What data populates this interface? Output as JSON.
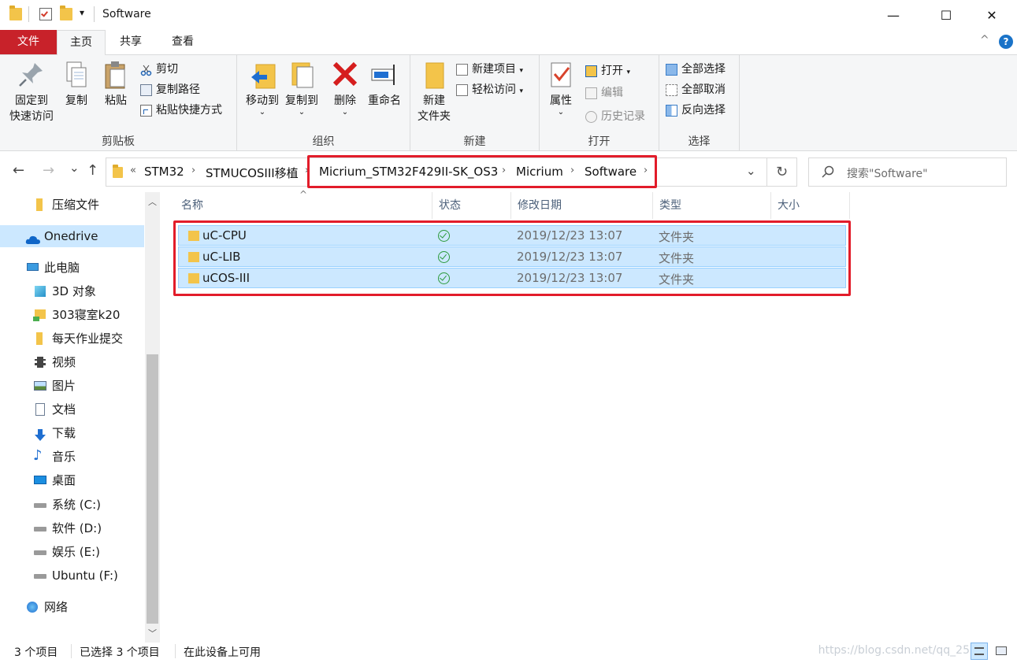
{
  "titlebar": {
    "title": "Software",
    "qa_dropdown": "▾",
    "minimize": "—",
    "maximize": "☐",
    "close": "✕"
  },
  "tabs": {
    "file": "文件",
    "home": "主页",
    "share": "共享",
    "view": "查看",
    "collapse": "^",
    "help": "?"
  },
  "ribbon": {
    "clipboard": {
      "label": "剪贴板",
      "pin_line1": "固定到",
      "pin_line2": "快速访问",
      "copy": "复制",
      "paste": "粘贴",
      "cut": "剪切",
      "copy_path": "复制路径",
      "paste_shortcut": "粘贴快捷方式"
    },
    "organize": {
      "label": "组织",
      "move_to": "移动到",
      "copy_to": "复制到",
      "delete": "删除",
      "rename": "重命名"
    },
    "new": {
      "label": "新建",
      "new_folder_line1": "新建",
      "new_folder_line2": "文件夹",
      "new_item": "新建项目",
      "easy_access": "轻松访问"
    },
    "open": {
      "label": "打开",
      "properties": "属性",
      "open": "打开",
      "edit": "编辑",
      "history": "历史记录"
    },
    "select": {
      "label": "选择",
      "select_all": "全部选择",
      "select_none": "全部取消",
      "invert": "反向选择"
    }
  },
  "address": {
    "back": "←",
    "forward": "→",
    "recent": "⌄",
    "up": "↑",
    "overflow": "«",
    "crumbs": [
      "STM32",
      "STMUCOSIII移植",
      "Micrium_STM32F429II-SK_OS3",
      "Micrium",
      "Software"
    ],
    "dropdown": "⌄",
    "refresh": "↻",
    "search_placeholder": "搜索\"Software\""
  },
  "nav": {
    "items": [
      {
        "label": "压缩文件",
        "icon": "folder-icon"
      },
      {
        "label": "Onedrive",
        "icon": "cloud-icon"
      },
      {
        "label": "此电脑",
        "icon": "computer-icon"
      },
      {
        "label": "3D 对象",
        "icon": "cube-icon"
      },
      {
        "label": "303寝室k20",
        "icon": "network-folder-icon"
      },
      {
        "label": "每天作业提交",
        "icon": "folder-icon"
      },
      {
        "label": "视频",
        "icon": "video-icon"
      },
      {
        "label": "图片",
        "icon": "picture-icon"
      },
      {
        "label": "文档",
        "icon": "document-icon"
      },
      {
        "label": "下载",
        "icon": "download-icon"
      },
      {
        "label": "音乐",
        "icon": "music-icon"
      },
      {
        "label": "桌面",
        "icon": "desktop-icon"
      },
      {
        "label": "系统 (C:)",
        "icon": "drive-icon"
      },
      {
        "label": "软件 (D:)",
        "icon": "drive-icon"
      },
      {
        "label": "娱乐 (E:)",
        "icon": "drive-icon"
      },
      {
        "label": "Ubuntu (F:)",
        "icon": "drive-icon"
      },
      {
        "label": "网络",
        "icon": "network-icon"
      }
    ]
  },
  "filelist": {
    "columns": [
      "名称",
      "状态",
      "修改日期",
      "类型",
      "大小"
    ],
    "rows": [
      {
        "name": "uC-CPU",
        "date": "2019/12/23 13:07",
        "type": "文件夹",
        "size": ""
      },
      {
        "name": "uC-LIB",
        "date": "2019/12/23 13:07",
        "type": "文件夹",
        "size": ""
      },
      {
        "name": "uCOS-III",
        "date": "2019/12/23 13:07",
        "type": "文件夹",
        "size": ""
      }
    ]
  },
  "statusbar": {
    "count": "3 个项目",
    "selected": "已选择 3 个项目",
    "availability": "在此设备上可用",
    "watermark": "https://blog.csdn.net/qq_25"
  },
  "colors": {
    "highlight_box": "#e21c2a",
    "selection": "#cce8ff",
    "file_tab": "#c8222a"
  }
}
